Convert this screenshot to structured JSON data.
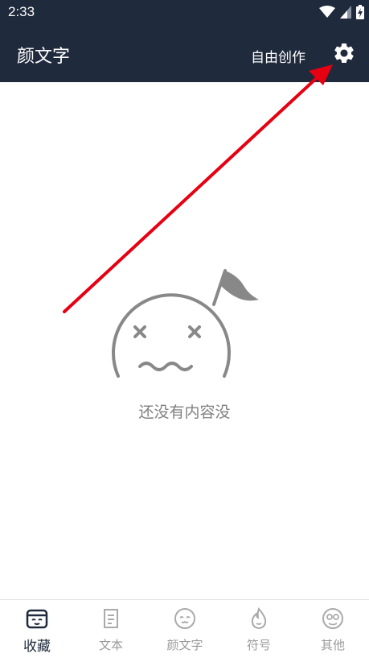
{
  "status_bar": {
    "time": "2:33"
  },
  "app_bar": {
    "title": "颜文字",
    "create_label": "自由创作"
  },
  "empty_state": {
    "message": "还没有内容没"
  },
  "tabs": [
    {
      "label": "收藏",
      "icon": "favorites-icon",
      "active": true
    },
    {
      "label": "文本",
      "icon": "text-icon",
      "active": false
    },
    {
      "label": "颜文字",
      "icon": "kaomoji-icon",
      "active": false
    },
    {
      "label": "符号",
      "icon": "symbol-icon",
      "active": false
    },
    {
      "label": "其他",
      "icon": "other-icon",
      "active": false
    }
  ],
  "colors": {
    "header_bg": "#1f2a3c",
    "arrow": "#e60012",
    "muted": "#808080"
  }
}
